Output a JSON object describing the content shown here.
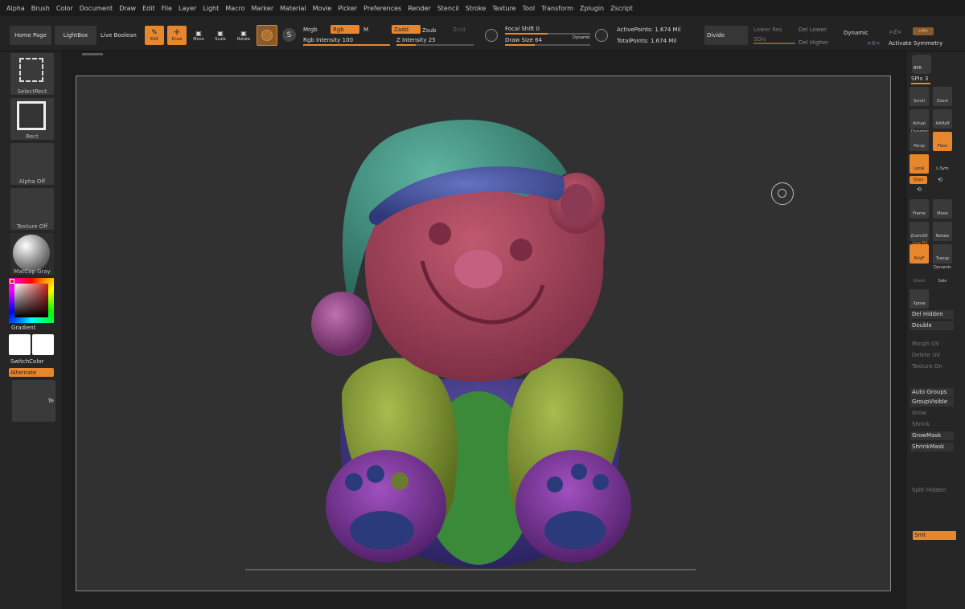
{
  "menu": [
    "Alpha",
    "Brush",
    "Color",
    "Document",
    "Draw",
    "Edit",
    "File",
    "Layer",
    "Light",
    "Macro",
    "Marker",
    "Material",
    "Movie",
    "Picker",
    "Preferences",
    "Render",
    "Stencil",
    "Stroke",
    "Texture",
    "Tool",
    "Transform",
    "Zplugin",
    "Zscript"
  ],
  "toolbar": {
    "home_page": "Home Page",
    "lightbox": "LightBox",
    "live_boolean": "Live Boolean",
    "edit": "Edit",
    "draw": "Draw",
    "move": "Move",
    "scale": "Scale",
    "rotate": "Rotate",
    "mrgb": "Mrgb",
    "rgb": "Rgb",
    "m": "M",
    "rgb_intensity": "Rgb Intensity 100",
    "zadd": "Zadd",
    "zsub": "Zsub",
    "zcut": "Zcut",
    "z_intensity": "Z Intensity 25",
    "focal_shift": "Focal Shift 0",
    "draw_size": "Draw Size 64",
    "dynamic_small": "Dynamic",
    "active_points": "ActivePoints: 1.674 Mil",
    "total_points": "TotalPoints: 1.674 Mil",
    "divide": "Divide",
    "lower_res": "Lower Res",
    "sdiv": "SDiv",
    "del_lower": "Del Lower",
    "del_higher": "Del Higher",
    "dynamic": "Dynamic",
    "activate_symmetry": "Activate Symmetry",
    "sym_z": ">Z<",
    "sym_m": ">M<",
    "sym_x": ">X<",
    "rgb_intensity_level": 1.0,
    "z_intensity_level": 0.25,
    "draw_size_level": 0.35,
    "focal_shift_level": 0.5
  },
  "left": {
    "select_rect": "SelectRect",
    "rect": "Rect",
    "alpha_off": "Alpha Off",
    "texture_off": "Texture Off",
    "matcap": "MatCap Gray",
    "gradient": "Gradient",
    "switch_color": "SwitchColor",
    "alternate": "Alternate",
    "te": "Te"
  },
  "right": {
    "spix": "SPix 3",
    "bpr": "BPR",
    "scroll": "Scroll",
    "zoom": "Zoom",
    "actual": "Actual",
    "aahalf": "AAHalf",
    "dynamic": "Dynamic",
    "persp": "Persp",
    "floor": "Floor",
    "local": "Local",
    "lsym": "L.Sym",
    "xyz": "Qxyz",
    "frame": "Frame",
    "move": "Move",
    "zoom3d": "Zoom3D",
    "rotate": "Rotate",
    "line_fill": "Line Fill",
    "polyf": "PolyF",
    "transp": "Transp",
    "ghost": "Ghost",
    "solo": "Solo",
    "xpose": "Xpose",
    "del_hidden": "Del Hidden",
    "double": "Double",
    "morph_uv": "Morph UV",
    "delete_uv": "Delete UV",
    "texture_on": "Texture On",
    "auto_groups": "Auto Groups",
    "group_visible": "GroupVisible",
    "grow": "Grow",
    "shrink": "Shrink",
    "grow_mask": "GrowMask",
    "shrink_mask": "ShrinkMask",
    "split_hidden": "Split Hidden",
    "smt": "Smt"
  },
  "colors": {
    "accent": "#e8862e",
    "hat": "#4e9a8a",
    "hat_band": "#4c5aa0",
    "face": "#a8455e",
    "pompom": "#9a4f8e",
    "jacket": "#8aa03a",
    "belly": "#3f8a3f",
    "body": "#4a3f8a",
    "paw": "#7a3a9a"
  }
}
